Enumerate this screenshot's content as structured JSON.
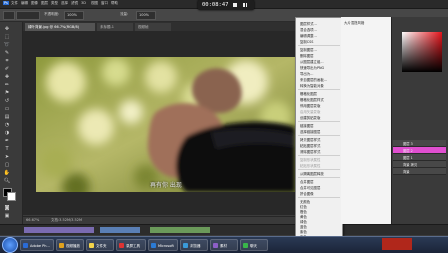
{
  "menubar": {
    "items": [
      "Ps",
      "文件",
      "编辑",
      "图像",
      "图层",
      "类型",
      "选择",
      "滤镜",
      "3D",
      "视图",
      "窗口",
      "帮助"
    ]
  },
  "options": {
    "tool_preset": "",
    "label1": "不透明度:",
    "value1": "100%",
    "label2": "流量:",
    "value2": "100%"
  },
  "player": {
    "time": "00:08:47",
    "stop_icon": "stop-icon",
    "pause_icon": "pause-icon"
  },
  "tabs": [
    {
      "label": "绿叶背景.jpg @ 66.7%(RGB/8)",
      "active": true
    },
    {
      "label": "未标题-1",
      "active": false
    },
    {
      "label": "视频帧",
      "active": false
    }
  ],
  "canvas": {
    "subtitle": "再有你 出现"
  },
  "status": {
    "zoom": "66.67%",
    "doc": "文档:3.52M/3.52M"
  },
  "context_menu": {
    "items": [
      {
        "label": "图层样式...",
        "dim": false
      },
      {
        "label": "混合选项...",
        "dim": false
      },
      {
        "label": "编辑调整...",
        "dim": false
      },
      {
        "label": "复制CSS",
        "dim": false
      },
      {
        "label": "复制图层...",
        "dim": false
      },
      {
        "label": "删除图层",
        "dim": false
      },
      {
        "label": "从图层建立组...",
        "dim": false
      },
      {
        "label": "快速导出为PNG",
        "dim": false
      },
      {
        "label": "导出为...",
        "dim": false
      },
      {
        "label": "来自图层的画板...",
        "dim": false
      },
      {
        "label": "转换为智能对象",
        "dim": false
      },
      {
        "label": "栅格化图层",
        "dim": false
      },
      {
        "label": "栅格化图层样式",
        "dim": false
      },
      {
        "label": "停用图层蒙版",
        "dim": false
      },
      {
        "label": "启用矢量蒙版",
        "dim": true
      },
      {
        "label": "创建剪贴蒙版",
        "dim": false
      },
      {
        "label": "链接图层",
        "dim": false
      },
      {
        "label": "选择链接图层",
        "dim": false
      },
      {
        "label": "拷贝图层样式",
        "dim": false
      },
      {
        "label": "粘贴图层样式",
        "dim": false
      },
      {
        "label": "清除图层样式",
        "dim": false
      },
      {
        "label": "复制形状属性",
        "dim": true
      },
      {
        "label": "粘贴形状属性",
        "dim": true
      },
      {
        "label": "从隔离图层释放",
        "dim": false
      },
      {
        "label": "合并图层",
        "dim": false
      },
      {
        "label": "合并可见图层",
        "dim": false
      },
      {
        "label": "拼合图像",
        "dim": false
      },
      {
        "label": "无颜色",
        "dim": false
      },
      {
        "label": "红色",
        "dim": false
      },
      {
        "label": "橙色",
        "dim": false
      },
      {
        "label": "黄色",
        "dim": false
      },
      {
        "label": "绿色",
        "dim": false
      },
      {
        "label": "蓝色",
        "dim": false
      },
      {
        "label": "紫色",
        "dim": false
      },
      {
        "label": "灰色",
        "dim": false
      },
      {
        "label": "明信片",
        "dim": false
      },
      {
        "label": "从所选图层新建3D模型",
        "dim": false
      }
    ]
  },
  "panel_mid": {
    "header": "大片混搭风格"
  },
  "layers": [
    {
      "label": "图层 3"
    },
    {
      "label": "图层 2"
    },
    {
      "label": "图层 1"
    },
    {
      "label": "背景 拷贝"
    },
    {
      "label": "背景"
    }
  ],
  "taskbar": {
    "buttons": [
      {
        "label": "Adobe Ph..."
      },
      {
        "label": "视频播放"
      },
      {
        "label": "文件夹"
      },
      {
        "label": "录屏工具"
      },
      {
        "label": "Microsoft"
      },
      {
        "label": "浏览器"
      },
      {
        "label": "素材"
      },
      {
        "label": "聊天"
      }
    ],
    "logo": "",
    "clock": ""
  }
}
